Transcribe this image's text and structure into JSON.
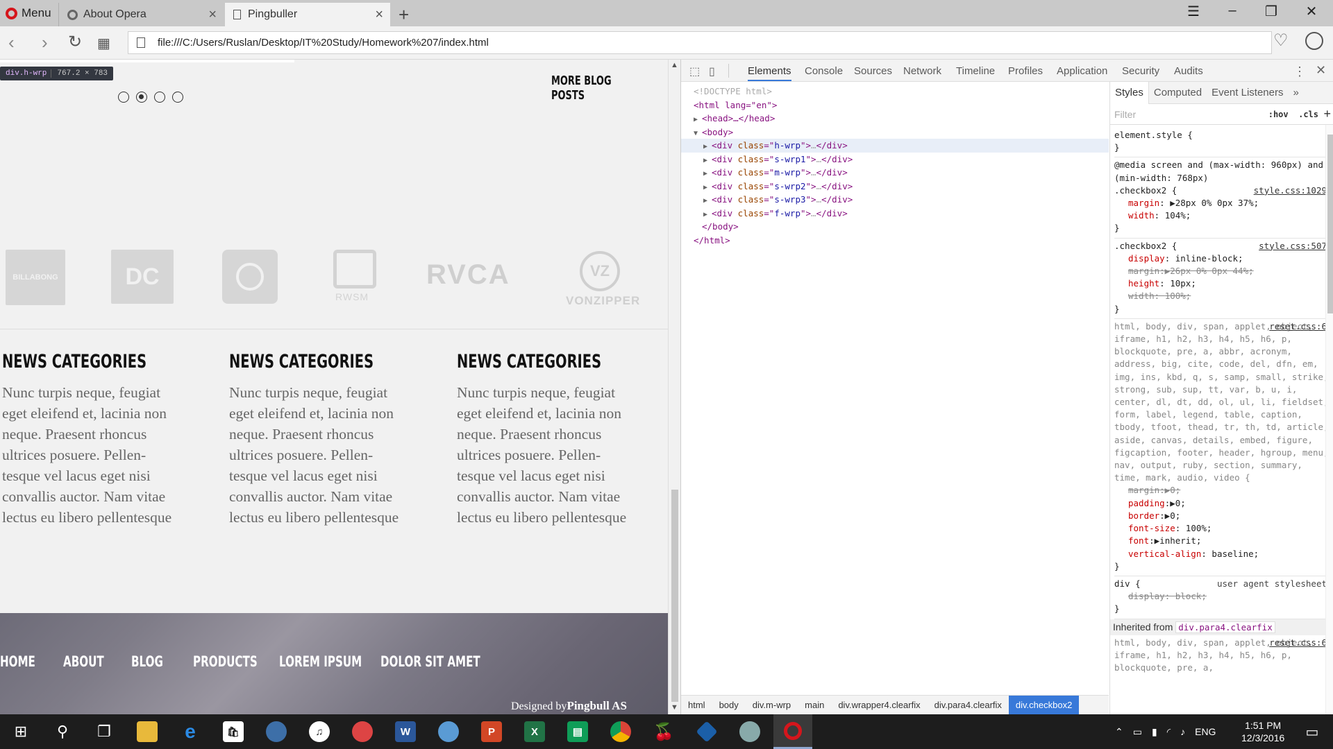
{
  "browser": {
    "menu_label": "Menu",
    "tabs": [
      {
        "title": "About Opera"
      },
      {
        "title": "Pingbuller"
      }
    ],
    "url": "file:///C:/Users/Ruslan/Desktop/IT%20Study/Homework%207/index.html"
  },
  "page": {
    "highlight_tag": {
      "name": "div.h-wrp",
      "size": "767.2 × 783"
    },
    "slider_dots": 4,
    "slider_active_index": 1,
    "more_posts_label": "MORE BLOG POSTS",
    "brands": [
      "BILLABONG",
      "DC",
      "ELEMENT",
      "RWSM",
      "RVCA",
      "VONZIPPER"
    ],
    "news": [
      {
        "title": "NEWS CATEGORIES",
        "text": "Nunc turpis neque, feugiat eget eleifend et, lacinia non neque. Praesent rhoncus ultrices posuere. Pellen-tesque vel lacus eget nisi convallis auctor. Nam vitae lectus eu libero pellentesque"
      },
      {
        "title": "NEWS CATEGORIES",
        "text": "Nunc turpis neque, feugiat eget eleifend et, lacinia non neque. Praesent rhoncus ultrices posuere. Pellen-tesque vel lacus eget nisi convallis auctor. Nam vitae lectus eu libero pellentesque"
      },
      {
        "title": "NEWS CATEGORIES",
        "text": "Nunc turpis neque, feugiat eget eleifend et, lacinia non neque. Praesent rhoncus ultrices posuere. Pellen-tesque vel lacus eget nisi convallis auctor. Nam vitae lectus eu libero pellentesque"
      }
    ],
    "footer_nav": [
      "HOME",
      "ABOUT",
      "BLOG",
      "PRODUCTS",
      "LOREM IPSUM",
      "DOLOR SIT AMET"
    ],
    "designed_by": "Designed by",
    "designed_company": "Pingbull AS"
  },
  "devtools": {
    "tabs": [
      "Elements",
      "Console",
      "Sources",
      "Network",
      "Timeline",
      "Profiles",
      "Application",
      "Security",
      "Audits"
    ],
    "active_tab": "Elements",
    "dom": {
      "doctype": "<!DOCTYPE html>",
      "html_open": "<html lang=\"en\">",
      "head": "<head>…</head>",
      "body_open": "<body>",
      "body_children": [
        "h-wrp",
        "s-wrp1",
        "m-wrp",
        "s-wrp2",
        "s-wrp3",
        "f-wrp"
      ],
      "body_close": "</body>",
      "html_close": "</html>"
    },
    "breadcrumbs": [
      "html",
      "body",
      "div.m-wrp",
      "main",
      "div.wrapper4.clearfix",
      "div.para4.clearfix",
      "div.checkbox2"
    ],
    "styles_tabs": [
      "Styles",
      "Computed",
      "Event Listeners"
    ],
    "filter_placeholder": "Filter",
    "filter_hov": ":hov",
    "filter_cls": ".cls",
    "rules": {
      "element_style": "element.style {",
      "media": "@media screen and (max-width: 960px) and (min-width: 768px)",
      "checkbox_1029": {
        "selector": ".checkbox2 {",
        "source": "style.css:1029",
        "margin": "28px 0% 0px 37%;",
        "width": "104%;"
      },
      "checkbox_507": {
        "selector": ".checkbox2 {",
        "source": "style.css:507",
        "display": "inline-block;",
        "margin": "26px 0% 0px 44%;",
        "height": "10px;",
        "width": "100%;"
      },
      "reset": {
        "selector": "html, body, div, span, applet, object, iframe, h1, h2, h3, h4, h5, h6, p, blockquote, pre, a, abbr, acronym, address, big, cite, code, del, dfn, em, img, ins, kbd, q, s, samp, small, strike, strong, sub, sup, tt, var, b, u, i, center, dl, dt, dd, ol, ul, li, fieldset, form, label, legend, table, caption, tbody, tfoot, thead, tr, th, td, article, aside, canvas, details, embed, figure, figcaption, footer, header, hgroup, menu, nav, output, ruby, section, summary, time, mark, audio, video {",
        "source": "reset.css:6",
        "margin": "0;",
        "padding": "0;",
        "border": "0;",
        "font_size": "100%;",
        "font": "inherit;",
        "vertical_align": "baseline;"
      },
      "ua": {
        "selector": "div {",
        "source": "user agent stylesheet",
        "display": "block;"
      },
      "inherited_label": "Inherited from",
      "inherited_from": "div.para4.clearfix",
      "reset2_selector": "html, body, div, span, applet, object, iframe, h1, h2, h3, h4, h5, h6, p, blockquote, pre, a,",
      "reset2_source": "reset.css:6"
    }
  },
  "taskbar": {
    "time": "1:51 PM",
    "date": "12/3/2016",
    "lang": "ENG"
  }
}
